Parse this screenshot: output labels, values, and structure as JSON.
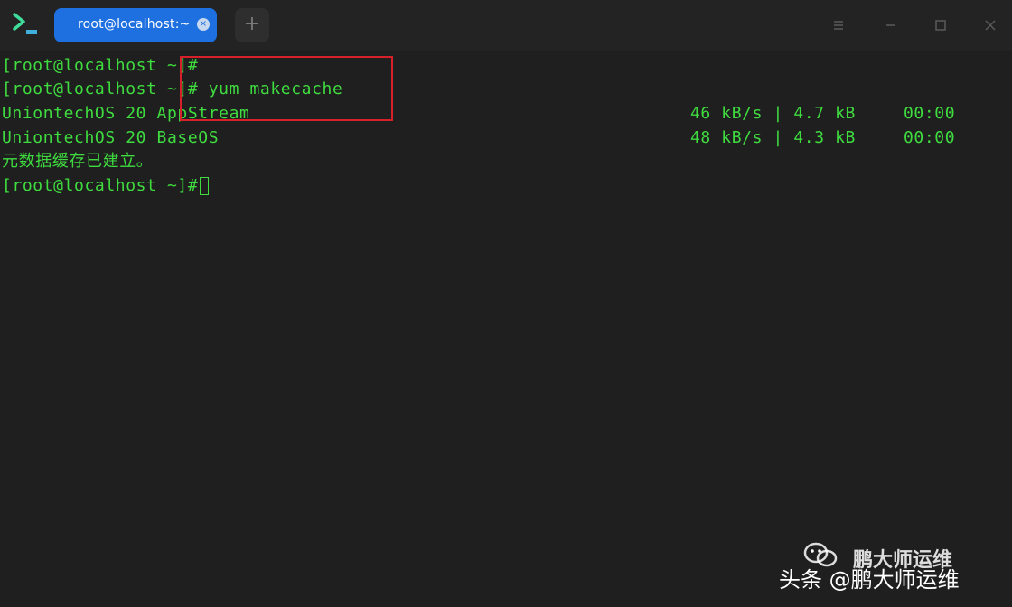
{
  "tab": {
    "title": "root@localhost:~",
    "close_glyph": "×"
  },
  "new_tab_glyph": "+",
  "icons": {
    "app": "terminal-icon",
    "menu": "menu-icon",
    "minimize": "minimize-icon",
    "maximize": "maximize-icon",
    "close": "close-icon"
  },
  "colors": {
    "terminal_text": "#3fdc3f",
    "tab_active": "#1e6fe0",
    "highlight": "#d8202a",
    "background": "#1f1f1f"
  },
  "terminal": {
    "lines": [
      "[root@localhost ~]#",
      "[root@localhost ~]# yum makecache",
      "UniontechOS 20 AppStream",
      "UniontechOS 20 BaseOS",
      "元数据缓存已建立。",
      "[root@localhost ~]#"
    ],
    "downloads": [
      {
        "rate": "46 kB/s | 4.7 kB",
        "time": "00:00"
      },
      {
        "rate": "48 kB/s | 4.3 kB",
        "time": "00:00"
      }
    ]
  },
  "watermark": {
    "account": "鹏大师运维",
    "source": "头条 @鹏大师运维"
  }
}
